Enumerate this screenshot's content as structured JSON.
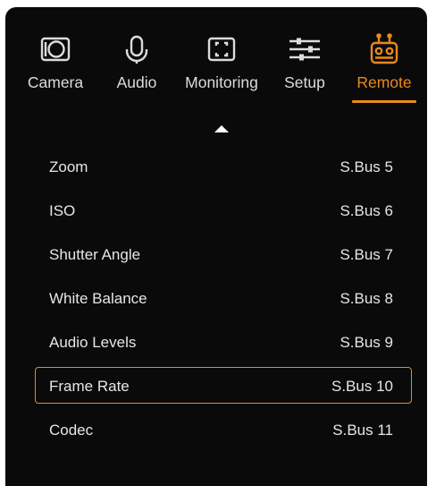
{
  "tabs": [
    {
      "label": "Camera",
      "icon": "camera-icon"
    },
    {
      "label": "Audio",
      "icon": "microphone-icon"
    },
    {
      "label": "Monitoring",
      "icon": "monitor-frame-icon"
    },
    {
      "label": "Setup",
      "icon": "sliders-icon"
    },
    {
      "label": "Remote",
      "icon": "remote-controller-icon",
      "active": true
    }
  ],
  "colors": {
    "accent": "#e88a1c",
    "background": "#0a0a0a",
    "text": "#e6e6e6"
  },
  "scroll_indicator": "up-arrow-icon",
  "remote_list": [
    {
      "name": "Zoom",
      "value": "S.Bus 5"
    },
    {
      "name": "ISO",
      "value": "S.Bus 6"
    },
    {
      "name": "Shutter Angle",
      "value": "S.Bus 7"
    },
    {
      "name": "White Balance",
      "value": "S.Bus 8"
    },
    {
      "name": "Audio Levels",
      "value": "S.Bus 9"
    },
    {
      "name": "Frame Rate",
      "value": "S.Bus 10",
      "selected": true
    },
    {
      "name": "Codec",
      "value": "S.Bus 11"
    }
  ]
}
